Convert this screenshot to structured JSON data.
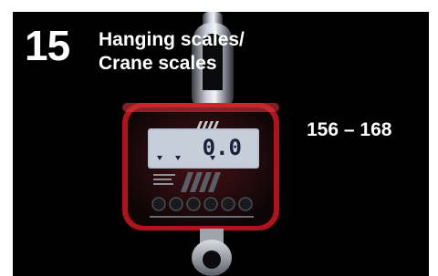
{
  "chapter": {
    "number": "15",
    "title_line1": "Hanging scales/",
    "title_line2": "Crane scales",
    "pages": "156 – 168"
  },
  "product": {
    "display_value": "0.0"
  },
  "colors": {
    "background": "#000000",
    "text": "#ffffff",
    "housing": "#b0131b",
    "lcd": "#b9c2d2"
  }
}
